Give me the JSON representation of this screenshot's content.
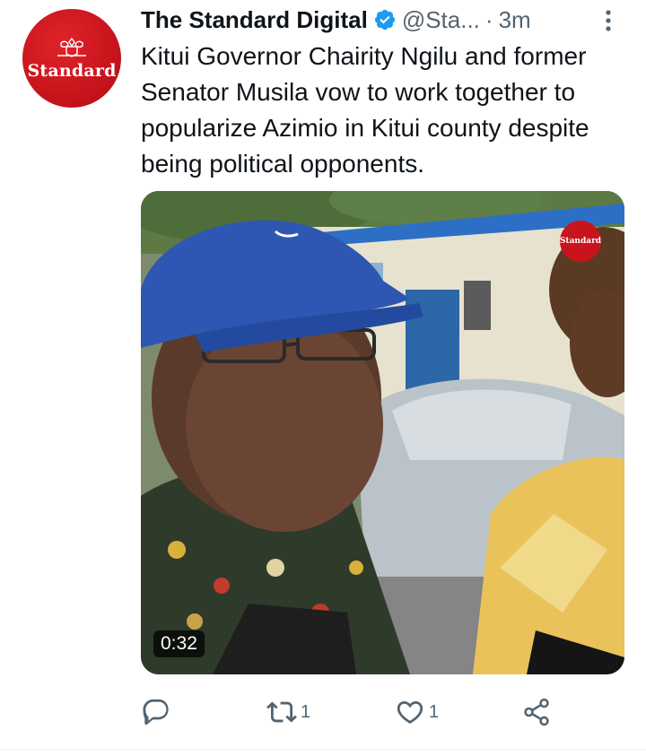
{
  "tweet": {
    "author": {
      "name": "The Standard Digital",
      "handle": "@Sta...",
      "avatar_text": "Standard",
      "verified": true
    },
    "separator": "·",
    "time": "3m",
    "text": "Kitui Governor Chairity Ngilu and former Senator Musila vow to work together to popularize Azimio in Kitui county despite being political opponents.",
    "media": {
      "type": "video",
      "duration": "0:32",
      "watermark_text": "Standard"
    },
    "actions": {
      "reply": {
        "icon": "reply-icon",
        "count": ""
      },
      "retweet": {
        "icon": "retweet-icon",
        "count": "1"
      },
      "like": {
        "icon": "heart-icon",
        "count": "1"
      },
      "share": {
        "icon": "share-icon",
        "count": ""
      }
    }
  },
  "colors": {
    "brand_red": "#c8141c",
    "verified_blue": "#1d9bf0",
    "secondary_text": "#536471",
    "primary_text": "#0f1419"
  }
}
